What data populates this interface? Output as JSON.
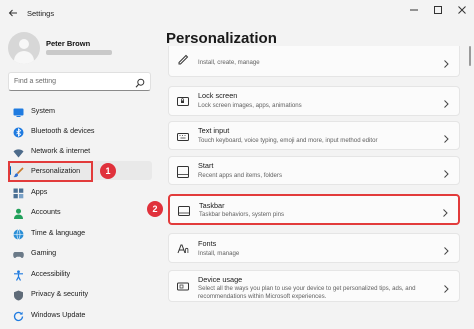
{
  "window": {
    "title": "Settings"
  },
  "user": {
    "name": "Peter Brown"
  },
  "search": {
    "placeholder": "Find a setting"
  },
  "sidebar": {
    "items": [
      {
        "label": "System",
        "icon": "monitor-icon"
      },
      {
        "label": "Bluetooth & devices",
        "icon": "bluetooth-icon"
      },
      {
        "label": "Network & internet",
        "icon": "wifi-icon"
      },
      {
        "label": "Personalization",
        "icon": "brush-icon",
        "selected": true
      },
      {
        "label": "Apps",
        "icon": "apps-icon"
      },
      {
        "label": "Accounts",
        "icon": "person-icon"
      },
      {
        "label": "Time & language",
        "icon": "globe-icon"
      },
      {
        "label": "Gaming",
        "icon": "controller-icon"
      },
      {
        "label": "Accessibility",
        "icon": "accessibility-icon"
      },
      {
        "label": "Privacy & security",
        "icon": "shield-icon"
      },
      {
        "label": "Windows Update",
        "icon": "update-icon"
      }
    ]
  },
  "annotations": {
    "step1": "1",
    "step2": "2",
    "color": "#e23b3b"
  },
  "main": {
    "title": "Personalization",
    "cards": [
      {
        "title": "",
        "subtitle": "Install, create, manage",
        "icon": "pen-icon"
      },
      {
        "title": "Lock screen",
        "subtitle": "Lock screen images, apps, animations",
        "icon": "lock-screen-icon"
      },
      {
        "title": "Text input",
        "subtitle": "Touch keyboard, voice typing, emoji and more, input method editor",
        "icon": "keyboard-icon"
      },
      {
        "title": "Start",
        "subtitle": "Recent apps and items, folders",
        "icon": "start-icon"
      },
      {
        "title": "Taskbar",
        "subtitle": "Taskbar behaviors, system pins",
        "icon": "taskbar-icon",
        "highlighted": true
      },
      {
        "title": "Fonts",
        "subtitle": "Install, manage",
        "icon": "fonts-icon"
      },
      {
        "title": "Device usage",
        "subtitle": "Select all the ways you plan to use your device to get personalized tips, ads, and recommendations within Microsoft experiences.",
        "icon": "device-usage-icon"
      }
    ]
  },
  "colors": {
    "accent": "#0067c0",
    "highlight": "#e23b3b",
    "badge": "#e0313b"
  }
}
